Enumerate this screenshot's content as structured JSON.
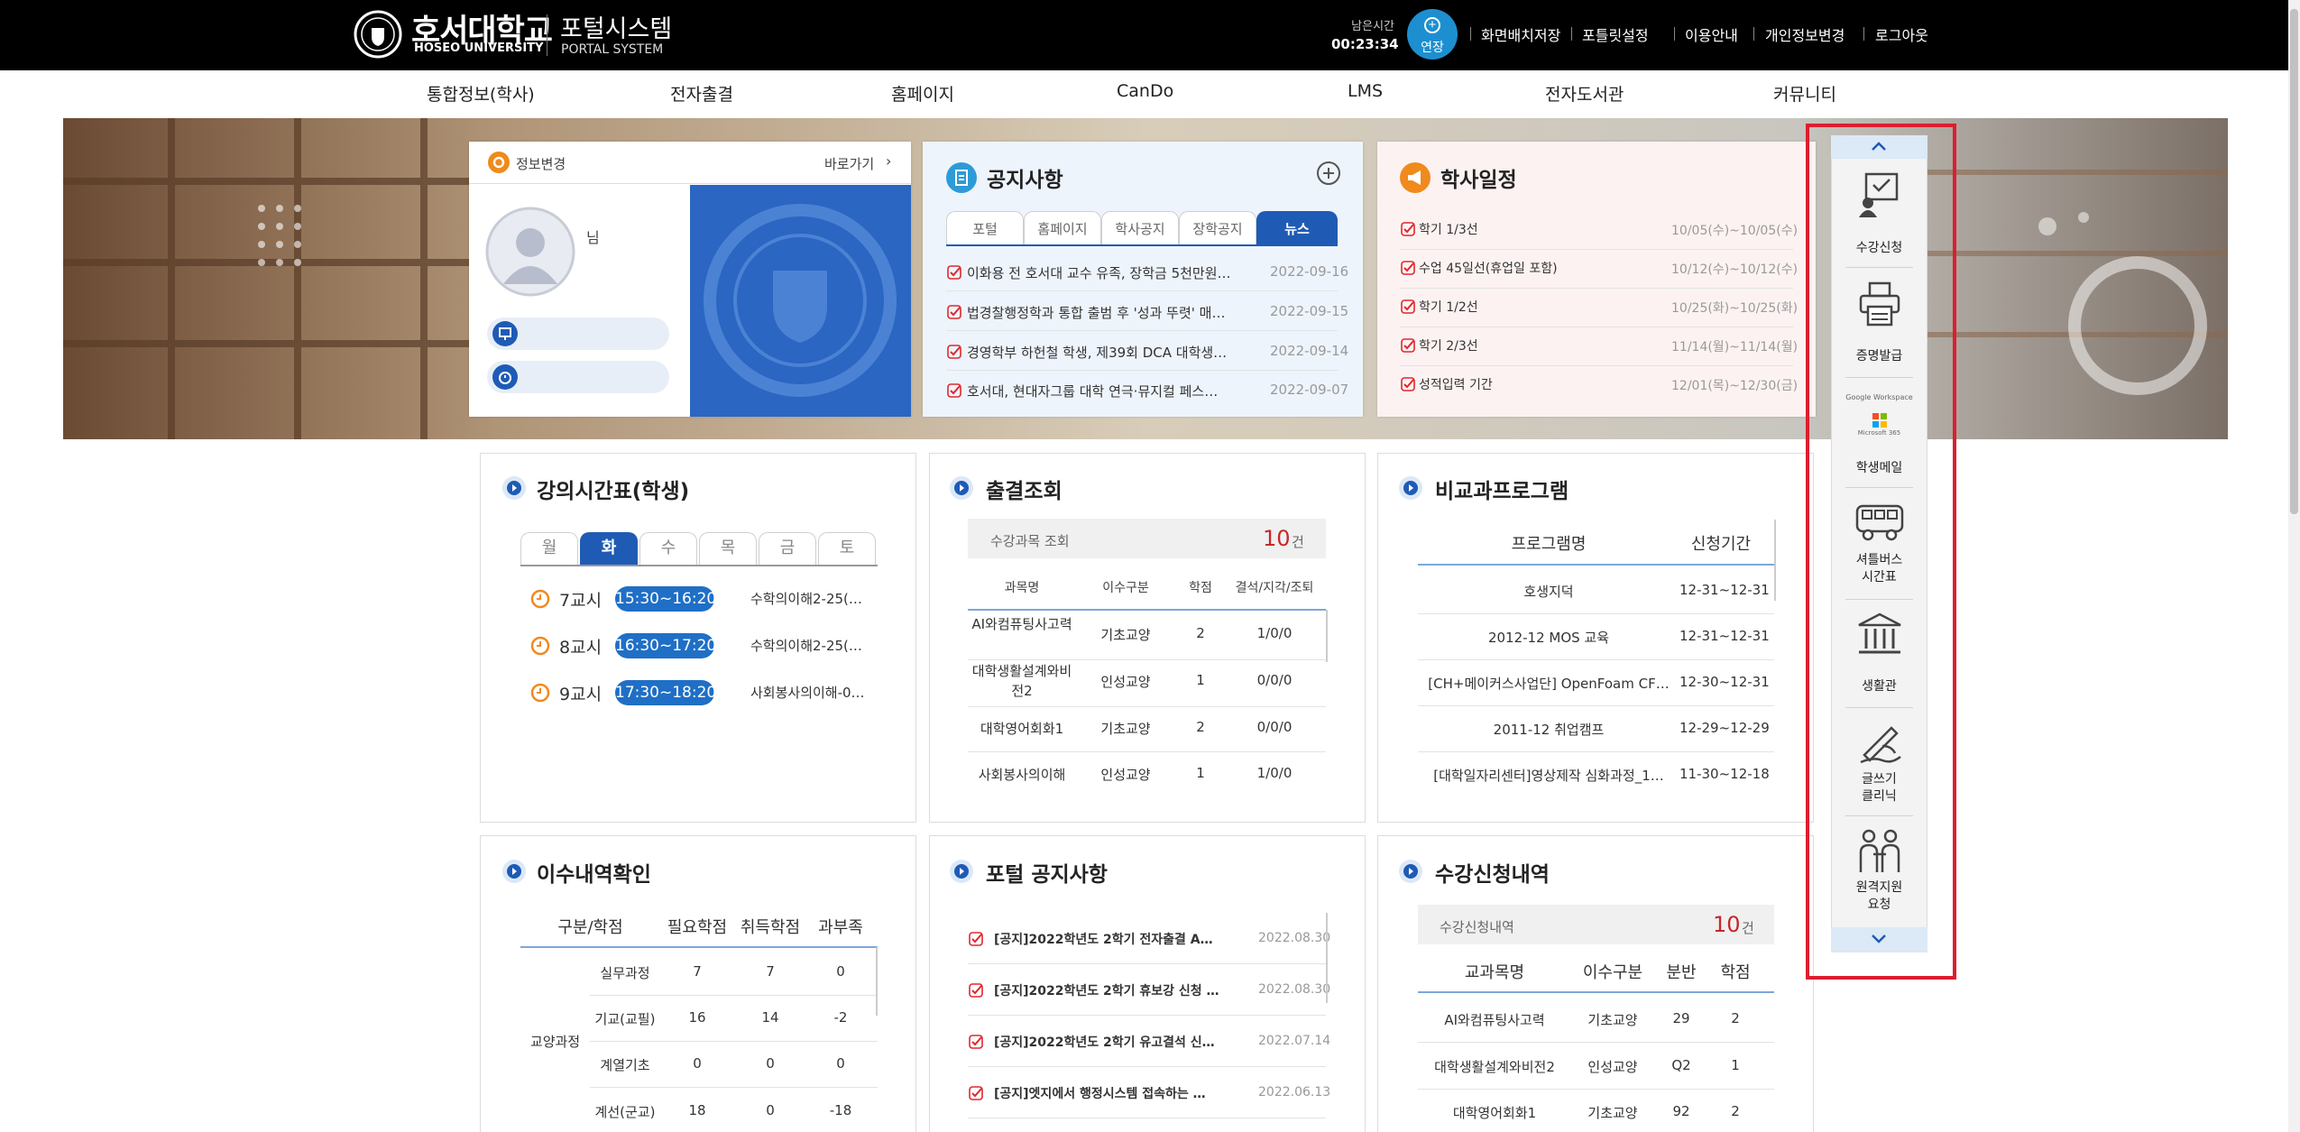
{
  "header": {
    "logo_ko": "호서대학교",
    "logo_en": "HOSEO UNIVERSITY",
    "portal_ko": "포털시스템",
    "portal_en": "PORTAL SYSTEM",
    "remaining_label": "남은시간",
    "remaining_time": "00:23:34",
    "extend_label": "연장",
    "links": [
      "화면배치저장",
      "포틀릿설정",
      "이용안내",
      "개인정보변경",
      "로그아웃"
    ]
  },
  "main_menu": [
    "통합정보(학사)",
    "전자출결",
    "홈페이지",
    "CanDo",
    "LMS",
    "전자도서관",
    "커뮤니티"
  ],
  "profile": {
    "change_label": "정보변경",
    "goto_label": "바로가기",
    "name_suffix": "님"
  },
  "notice": {
    "title": "공지사항",
    "tabs": [
      "포털",
      "홈페이지",
      "학사공지",
      "장학공지",
      "뉴스"
    ],
    "active_tab": 4,
    "items": [
      {
        "text": "이화용 전 호서대 교수 유족, 장학금 5천만원…",
        "date": "2022-09-16"
      },
      {
        "text": "법경찰행정학과 통합 출범 후 '성과 뚜렷' 매…",
        "date": "2022-09-15"
      },
      {
        "text": "경영학부 하헌철 학생, 제39회 DCA 대학생…",
        "date": "2022-09-14"
      },
      {
        "text": "호서대, 현대자그룹 대학 연극·뮤지컬 페스…",
        "date": "2022-09-07"
      }
    ]
  },
  "academic": {
    "title": "학사일정",
    "items": [
      {
        "text": "학기 1/3선",
        "date": "10/05(수)~10/05(수)"
      },
      {
        "text": "수업 45일선(휴업일 포함)",
        "date": "10/12(수)~10/12(수)"
      },
      {
        "text": "학기 1/2선",
        "date": "10/25(화)~10/25(화)"
      },
      {
        "text": "학기 2/3선",
        "date": "11/14(월)~11/14(월)"
      },
      {
        "text": "성적입력 기간",
        "date": "12/01(목)~12/30(금)"
      }
    ]
  },
  "timetable": {
    "title": "강의시간표(학생)",
    "days": [
      "월",
      "화",
      "수",
      "목",
      "금",
      "토"
    ],
    "active_day": 1,
    "rows": [
      {
        "period": "7교시",
        "time": "15:30~16:20",
        "course": "수학의이해2-25(…"
      },
      {
        "period": "8교시",
        "time": "16:30~17:20",
        "course": "수학의이해2-25(…"
      },
      {
        "period": "9교시",
        "time": "17:30~18:20",
        "course": "사회봉사의이해-0…"
      }
    ]
  },
  "attendance": {
    "title": "출결조회",
    "summary_label": "수강과목 조회",
    "summary_count": "10",
    "summary_unit": "건",
    "headers": [
      "과목명",
      "이수구분",
      "학점",
      "결석/지각/조퇴"
    ],
    "rows": [
      [
        "AI와컴퓨팅사고력",
        "기초교양",
        "2",
        "1/0/0"
      ],
      [
        "대학생활설계와비전2",
        "인성교양",
        "1",
        "0/0/0"
      ],
      [
        "대학영어회화1",
        "기초교양",
        "2",
        "0/0/0"
      ],
      [
        "사회봉사의이해",
        "인성교양",
        "1",
        "1/0/0"
      ]
    ]
  },
  "extracurricular": {
    "title": "비교과프로그램",
    "headers": [
      "프로그램명",
      "신청기간"
    ],
    "rows": [
      [
        "호생지덕",
        "12-31~12-31"
      ],
      [
        "2012-12 MOS 교육",
        "12-31~12-31"
      ],
      [
        "[CH+메이커스사업단] OpenFoam CF…",
        "12-30~12-31"
      ],
      [
        "2011-12 취업캠프",
        "12-29~12-29"
      ],
      [
        "[대학일자리센터]영상제작 심화과정_1…",
        "11-30~12-18"
      ]
    ]
  },
  "completion": {
    "title": "이수내역확인",
    "headers": [
      "구분/학점",
      "필요학점",
      "취득학점",
      "과부족"
    ],
    "group": "교양과정",
    "rows": [
      [
        "실무과정",
        "7",
        "7",
        "0"
      ],
      [
        "기교(교필)",
        "16",
        "14",
        "-2"
      ],
      [
        "계열기초",
        "0",
        "0",
        "0"
      ],
      [
        "계선(군교)",
        "18",
        "0",
        "-18"
      ]
    ]
  },
  "portal_notice": {
    "title": "포털 공지사항",
    "items": [
      {
        "text": "[공지]2022학년도 2학기 전자출결 A…",
        "date": "2022.08.30"
      },
      {
        "text": "[공지]2022학년도 2학기 휴보강 신청 …",
        "date": "2022.08.30"
      },
      {
        "text": "[공지]2022학년도 2학기 유고결석 신…",
        "date": "2022.07.14"
      },
      {
        "text": "[공지]엣지에서 행정시스템 접속하는 …",
        "date": "2022.06.13"
      }
    ]
  },
  "registration": {
    "title": "수강신청내역",
    "summary_label": "수강신청내역",
    "summary_count": "10",
    "summary_unit": "건",
    "headers": [
      "교과목명",
      "이수구분",
      "분반",
      "학점"
    ],
    "rows": [
      [
        "AI와컴퓨팅사고력",
        "기초교양",
        "29",
        "2"
      ],
      [
        "대학생활설계와비전2",
        "인성교양",
        "Q2",
        "1"
      ],
      [
        "대학영어회화1",
        "기초교양",
        "92",
        "2"
      ]
    ]
  },
  "quick_menu": {
    "items": [
      "수강신청",
      "증명발급",
      "학생메일",
      "셔틀버스\n시간표",
      "생활관",
      "글쓰기\n클리닉",
      "원격지원\n요청"
    ],
    "mail_logo_top": "Google Workspace",
    "mail_logo_bottom": "Microsoft 365"
  },
  "colors": {
    "accent": "#1f5bb5",
    "highlight_box": "#dc1e2e",
    "check": "#e0282e"
  }
}
